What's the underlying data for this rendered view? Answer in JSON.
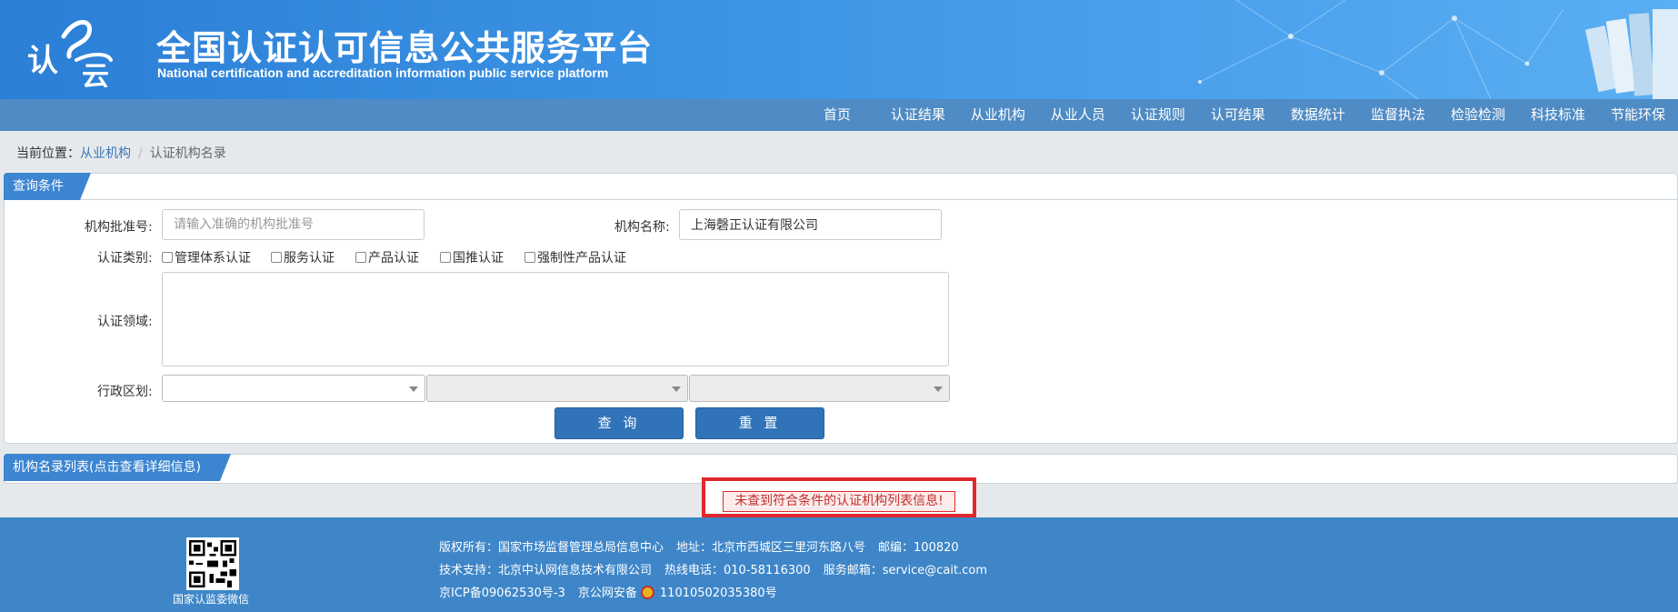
{
  "header": {
    "logo_text_1": "认",
    "logo_text_2": "云",
    "title": "全国认证认可信息公共服务平台",
    "subtitle": "National certification and accreditation information public service platform"
  },
  "nav": {
    "items": [
      "首页",
      "认证结果",
      "从业机构",
      "从业人员",
      "认证规则",
      "认可结果",
      "数据统计",
      "监督执法",
      "检验检测",
      "科技标准",
      "节能环保"
    ]
  },
  "breadcrumb": {
    "prefix": "当前位置：",
    "parent": "从业机构",
    "separator": "/",
    "current": "认证机构名录"
  },
  "query": {
    "panel_title": "查询条件",
    "approval_no_label": "机构批准号:",
    "approval_no_placeholder": "请输入准确的机构批准号",
    "approval_no_value": "",
    "org_name_label": "机构名称:",
    "org_name_value": "上海磬正认证有限公司",
    "category_label": "认证类别:",
    "categories": [
      "管理体系认证",
      "服务认证",
      "产品认证",
      "国推认证",
      "强制性产品认证"
    ],
    "domain_label": "认证领域:",
    "region_label": "行政区划:",
    "search_button": "查 询",
    "reset_button": "重 置"
  },
  "list": {
    "panel_title": "机构名录列表(点击查看详细信息)",
    "empty_message": "未查到符合条件的认证机构列表信息!"
  },
  "footer": {
    "qr_caption": "国家认监委微信",
    "line1": [
      "版权所有：国家市场监督管理总局信息中心",
      "地址：北京市西城区三里河东路八号",
      "邮编：100820"
    ],
    "line2": [
      "技术支持：北京中认网信息技术有限公司",
      "热线电话：010-58116300",
      "服务邮箱：service@cait.com"
    ],
    "icp": "京ICP备09062530号-3",
    "police_prefix": "京公网安备",
    "police_no": "11010502035380号"
  },
  "colors": {
    "banner": "#3b92e3",
    "nav": "#4f8bc4",
    "button": "#3073b8",
    "footer": "#3e86c8",
    "alert_border": "#e0282e"
  }
}
